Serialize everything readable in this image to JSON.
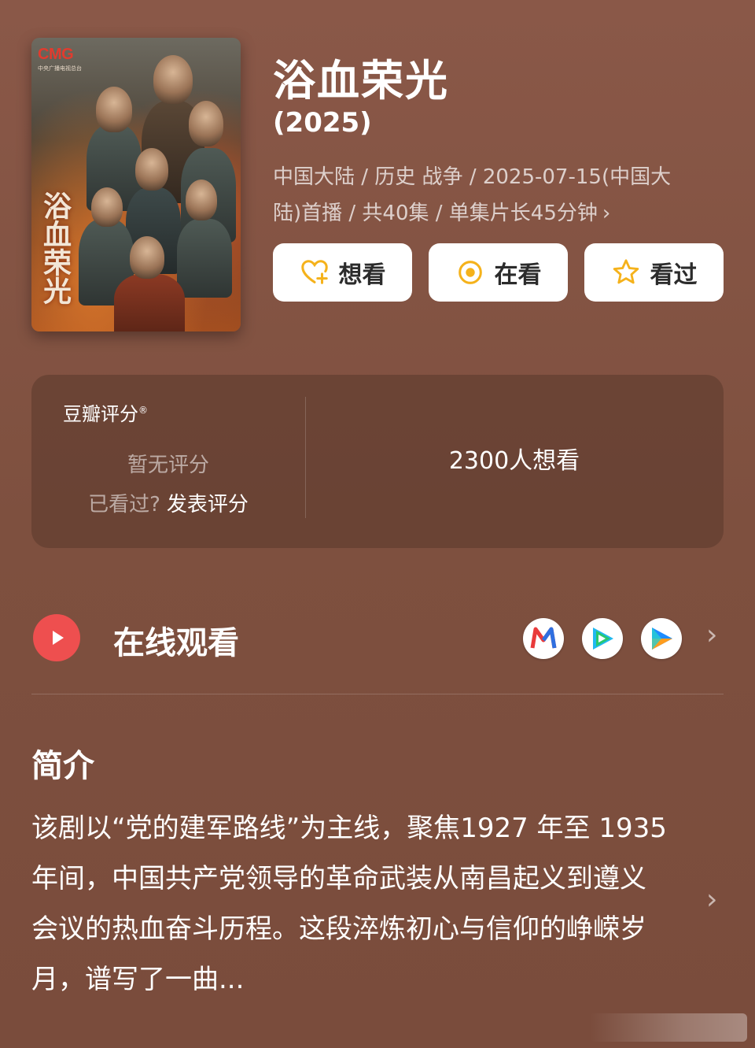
{
  "show": {
    "title": "浴血荣光",
    "year": "(2025)",
    "meta_line1": "中国大陆 / 历史 战争 / 2025-07-15(中国大",
    "meta_line2": "陆)首播 / 共40集 / 单集片长45分钟",
    "meta_chevron": "›"
  },
  "poster": {
    "logo": "CMG",
    "logo_sub": "中央广播电视总台",
    "vertical_title": "浴血荣光"
  },
  "actions": {
    "want": "想看",
    "watching": "在看",
    "watched": "看过"
  },
  "rating": {
    "brand": "豆瓣评分",
    "brand_mark": "®",
    "no_rating": "暂无评分",
    "seen_prompt": "已看过?",
    "rate_link": "发表评分",
    "want_count": "2300人想看"
  },
  "watch": {
    "title": "在线观看",
    "chevron": "›",
    "apps": [
      "mgtv-icon",
      "tencent-video-icon",
      "youku-icon"
    ]
  },
  "intro": {
    "heading": "简介",
    "text": "该剧以“党的建军路线”为主线，聚焦1927 年至 1935 年间，中国共产党领导的革命武装从南昌起义到遵义会议的热血奋斗历程。这段淬炼初心与信仰的峥嵘岁月，谱写了一曲...",
    "chevron": "›"
  },
  "colors": {
    "background": "#7d4f3f",
    "accent_star": "#f5b21b",
    "play_red": "#ee4f4f"
  }
}
